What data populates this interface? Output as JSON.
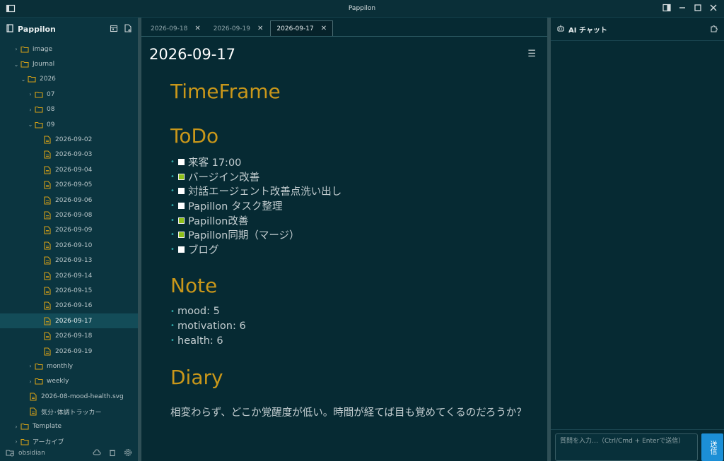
{
  "window": {
    "title": "Pappilon"
  },
  "sidebar": {
    "vault_name": "Pappilon",
    "tree": [
      {
        "label": "image",
        "type": "folder",
        "indent": 1,
        "expanded": false
      },
      {
        "label": "Journal",
        "type": "folder",
        "indent": 1,
        "expanded": true
      },
      {
        "label": "2026",
        "type": "folder",
        "indent": 2,
        "expanded": true
      },
      {
        "label": "07",
        "type": "folder",
        "indent": 3,
        "expanded": false
      },
      {
        "label": "08",
        "type": "folder",
        "indent": 3,
        "expanded": false
      },
      {
        "label": "09",
        "type": "folder",
        "indent": 3,
        "expanded": true
      },
      {
        "label": "2026-09-02",
        "type": "file",
        "indent": 4
      },
      {
        "label": "2026-09-03",
        "type": "file",
        "indent": 4
      },
      {
        "label": "2026-09-04",
        "type": "file",
        "indent": 4
      },
      {
        "label": "2026-09-05",
        "type": "file",
        "indent": 4
      },
      {
        "label": "2026-09-06",
        "type": "file",
        "indent": 4
      },
      {
        "label": "2026-09-08",
        "type": "file",
        "indent": 4
      },
      {
        "label": "2026-09-09",
        "type": "file",
        "indent": 4
      },
      {
        "label": "2026-09-10",
        "type": "file",
        "indent": 4
      },
      {
        "label": "2026-09-13",
        "type": "file",
        "indent": 4
      },
      {
        "label": "2026-09-14",
        "type": "file",
        "indent": 4
      },
      {
        "label": "2026-09-15",
        "type": "file",
        "indent": 4
      },
      {
        "label": "2026-09-16",
        "type": "file",
        "indent": 4
      },
      {
        "label": "2026-09-17",
        "type": "file",
        "indent": 4,
        "selected": true
      },
      {
        "label": "2026-09-18",
        "type": "file",
        "indent": 4
      },
      {
        "label": "2026-09-19",
        "type": "file",
        "indent": 4
      },
      {
        "label": "monthly",
        "type": "folder",
        "indent": 3,
        "expanded": false
      },
      {
        "label": "weekly",
        "type": "folder",
        "indent": 3,
        "expanded": false
      },
      {
        "label": "2026-08-mood-health.svg",
        "type": "file",
        "indent": 2
      },
      {
        "label": "気分･体調トラッカー",
        "type": "file",
        "indent": 2
      },
      {
        "label": "Template",
        "type": "folder",
        "indent": 1,
        "expanded": false
      },
      {
        "label": "アーカイブ",
        "type": "folder",
        "indent": 1,
        "expanded": false
      }
    ],
    "footer_name": "obsidian"
  },
  "tabs": [
    {
      "label": "2026-09-18",
      "active": false
    },
    {
      "label": "2026-09-19",
      "active": false
    },
    {
      "label": "2026-09-17",
      "active": true
    }
  ],
  "document": {
    "title": "2026-09-17",
    "sections": {
      "timeframe": "TimeFrame",
      "todo": "ToDo",
      "note": "Note",
      "diary": "Diary"
    },
    "todos": [
      {
        "text": "来客 17:00",
        "done": false
      },
      {
        "text": "バージイン改善",
        "done": true
      },
      {
        "text": "対話エージェント改善点洗い出し",
        "done": false
      },
      {
        "text": "Papillon タスク整理",
        "done": false
      },
      {
        "text": "Papillon改善",
        "done": true
      },
      {
        "text": "Papillon同期（マージ）",
        "done": true
      },
      {
        "text": "ブログ",
        "done": false
      }
    ],
    "notes": [
      "mood: 5",
      "motivation: 6",
      "health: 6"
    ],
    "diary_text": "相変わらず、どこか覚醒度が低い。時間が経てば目も覚めてくるのだろうか？"
  },
  "chat": {
    "title": "AI チャット",
    "input_placeholder": "質問を入力…（Ctrl/Cmd + Enterで送信）",
    "send_label": "送信"
  },
  "colors": {
    "heading": "#c9971a",
    "accent": "#1c8fd6",
    "bullet": "#2fa6a6",
    "checkbox_checked": "#8fbf1a"
  }
}
